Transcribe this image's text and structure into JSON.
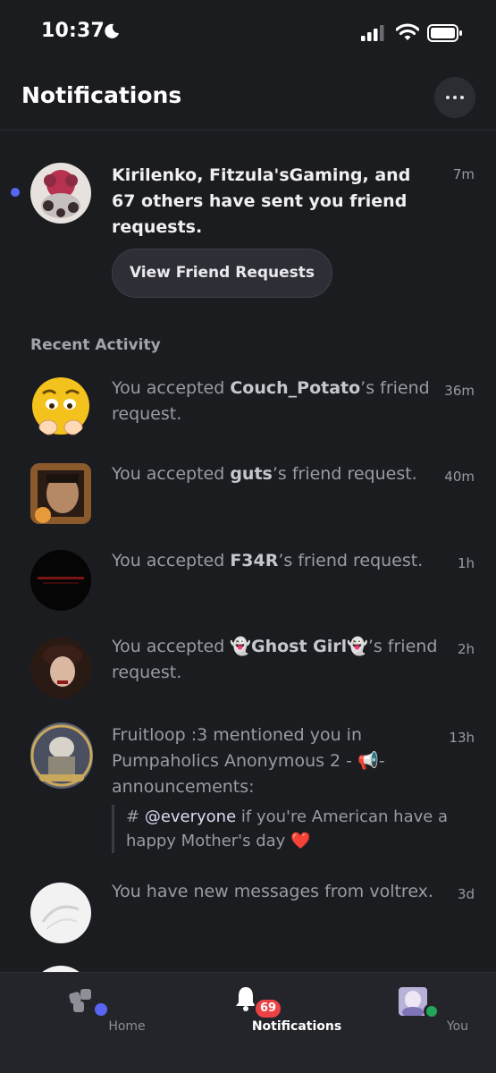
{
  "status_bar": {
    "time": "10:37"
  },
  "header": {
    "title": "Notifications"
  },
  "friend_requests": {
    "text": "Kirilenko, Fitzula'sGaming, and 67 others have sent you friend requests.",
    "time": "7m",
    "button_label": "View Friend Requests"
  },
  "recent": {
    "label": "Recent Activity",
    "items": [
      {
        "prefix": "You accepted ",
        "name": "Couch_Potato",
        "suffix": "’s friend request.",
        "time": "36m"
      },
      {
        "prefix": "You accepted ",
        "name": "guts",
        "suffix": "’s friend request.",
        "time": "40m"
      },
      {
        "prefix": "You accepted ",
        "name": "F34R",
        "suffix": "’s friend request.",
        "time": "1h"
      },
      {
        "prefix": "You accepted ",
        "name": "👻Ghost Girl👻",
        "suffix": "’s friend request.",
        "time": "2h"
      },
      {
        "text": "Fruitloop :3 mentioned you in Pumpaholics Anonymous 2 - 📢- announcements:",
        "time": "13h",
        "quote_hash": "# ",
        "quote_mention": "@everyone",
        "quote_rest": " if you're American have a happy Mother's day ❤️"
      },
      {
        "text": "You have new messages from voltrex.",
        "time": "3d"
      }
    ]
  },
  "tabbar": {
    "home": "Home",
    "notifications": "Notifications",
    "notifications_badge": "69",
    "you": "You"
  },
  "colors": {
    "accent": "#5865f2",
    "badge": "#ed4245",
    "online": "#23a55a"
  }
}
